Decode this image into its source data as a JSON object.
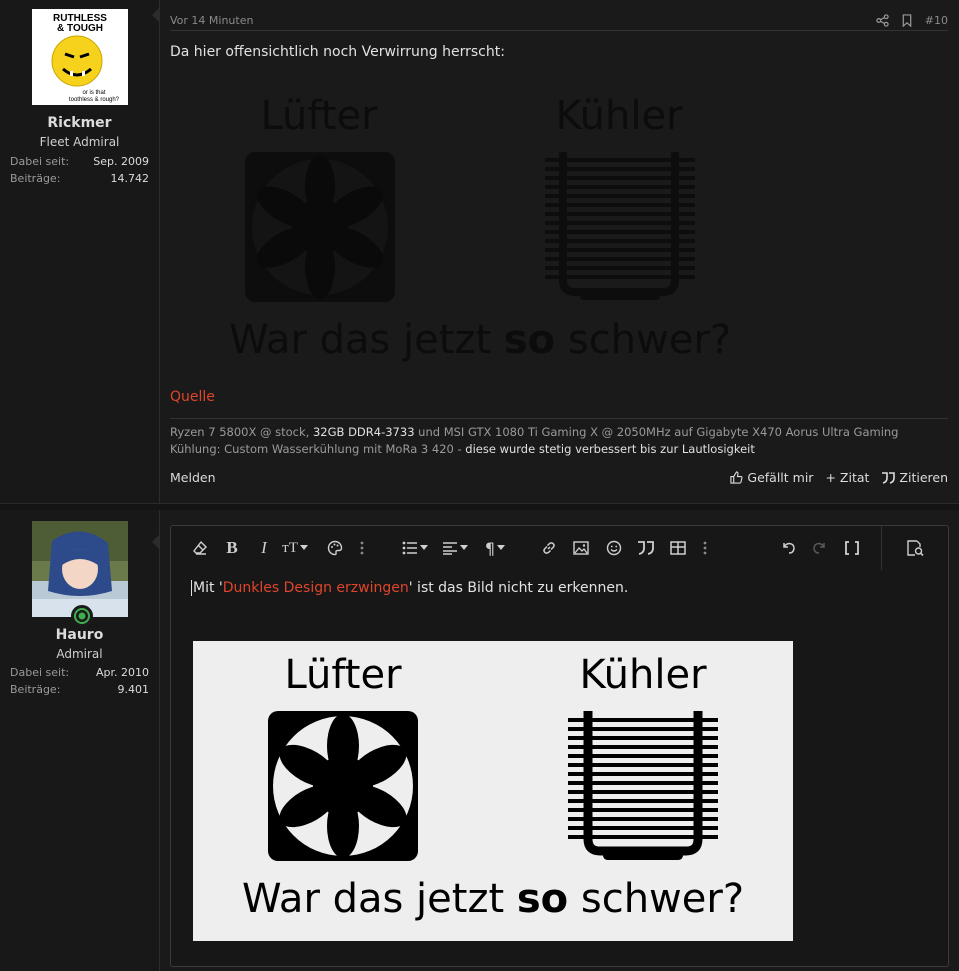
{
  "posts": [
    {
      "user": {
        "name": "Rickmer",
        "title": "Fleet Admiral",
        "avatar_text": [
          "RUTHLESS",
          "& TOUGH",
          "or is that",
          "toothless & rough?"
        ],
        "stats": [
          {
            "label": "Dabei seit:",
            "value": "Sep. 2009"
          },
          {
            "label": "Beiträge:",
            "value": "14.742"
          }
        ]
      },
      "time": "Vor 14 Minuten",
      "post_number": "#10",
      "text": "Da hier offensichtlich noch Verwirrung herrscht:",
      "image": {
        "label_left": "Lüfter",
        "label_right": "Kühler",
        "caption_pre": "War das jetzt ",
        "caption_bold": "so",
        "caption_post": " schwer?"
      },
      "source_link": "Quelle",
      "signature": {
        "line1_a": "Ryzen 7 5800X @ stock, ",
        "line1_b": "32GB DDR4-3733",
        "line1_c": " und MSI GTX 1080 Ti Gaming X @ 2050MHz auf Gigabyte X470 Aorus Ultra Gaming",
        "line2_a": "Kühlung: Custom Wasserkühlung mit MoRa 3 420 - ",
        "line2_b": "diese wurde stetig verbessert bis zur Lautlosigkeit"
      },
      "actions": {
        "report": "Melden",
        "like": "Gefällt mir",
        "quote_add": "Zitat",
        "quote": "Zitieren"
      }
    }
  ],
  "reply": {
    "user": {
      "name": "Hauro",
      "title": "Admiral",
      "stats": [
        {
          "label": "Dabei seit:",
          "value": "Apr. 2010"
        },
        {
          "label": "Beiträge:",
          "value": "9.401"
        }
      ]
    },
    "editor": {
      "text_pre": "Mit '",
      "text_link": "Dunkles Design erzwingen",
      "text_post": "' ist das Bild nicht zu erkennen.",
      "image": {
        "label_left": "Lüfter",
        "label_right": "Kühler",
        "caption_pre": "War das jetzt ",
        "caption_bold": "so",
        "caption_post": " schwer?"
      }
    }
  },
  "colors": {
    "accent": "#e0452b",
    "online": "#3fae4f",
    "background": "#1a1a1a"
  }
}
